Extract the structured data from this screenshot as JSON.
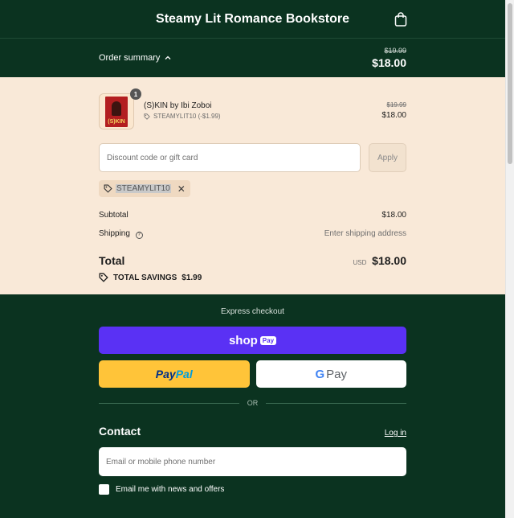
{
  "header": {
    "store_name": "Steamy Lit Romance Bookstore",
    "cart_icon": "shopping-bag-icon"
  },
  "summary": {
    "toggle_label": "Order summary",
    "original_price": "$19.99",
    "total_price": "$18.00"
  },
  "item": {
    "quantity": "1",
    "name": "(S)KIN by Ibi Zoboi",
    "discount_label": "STEAMYLIT10 (-$1.99)",
    "original_price": "$19.99",
    "price": "$18.00",
    "cover_text": "(S)KIN"
  },
  "discount": {
    "placeholder": "Discount code or gift card",
    "apply_label": "Apply",
    "applied_code": "STEAMYLIT10"
  },
  "totals": {
    "subtotal_label": "Subtotal",
    "subtotal_value": "$18.00",
    "shipping_label": "Shipping",
    "shipping_value": "Enter shipping address",
    "total_label": "Total",
    "currency": "USD",
    "total_value": "$18.00",
    "savings_label": "TOTAL SAVINGS",
    "savings_value": "$1.99"
  },
  "checkout": {
    "express_label": "Express checkout",
    "shop_pay_text": "shop",
    "shop_pay_badge": "Pay",
    "paypal_part1": "Pay",
    "paypal_part2": "Pal",
    "gpay_g": "G",
    "gpay_text": "Pay",
    "or_label": "OR",
    "contact_title": "Contact",
    "login_label": "Log in",
    "email_placeholder": "Email or mobile phone number",
    "newsletter_label": "Email me with news and offers"
  },
  "colors": {
    "brand_dark_green": "#0b3320",
    "summary_bg": "#f9e9d8",
    "shop_pay_purple": "#5a31f4",
    "paypal_yellow": "#ffc439"
  }
}
